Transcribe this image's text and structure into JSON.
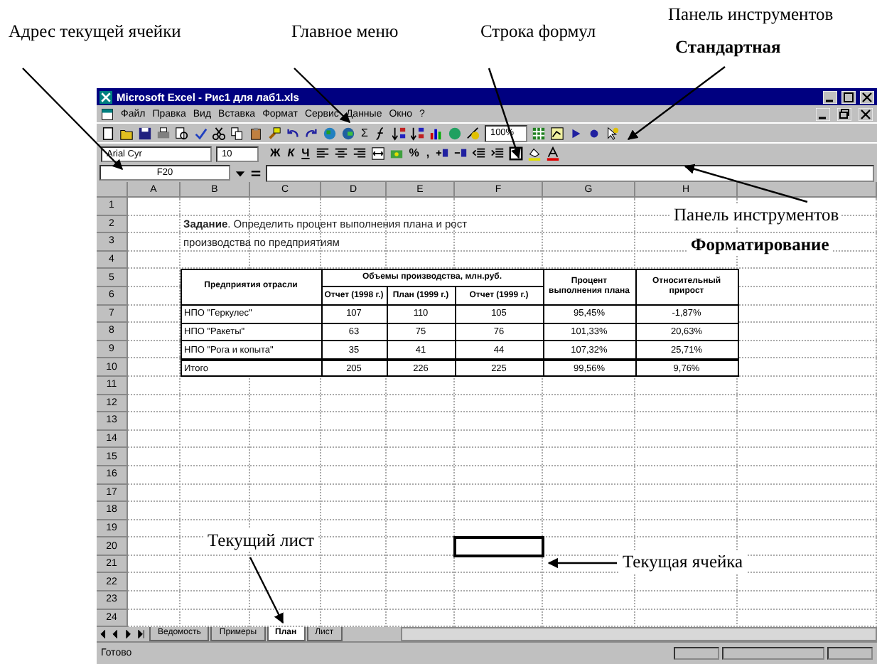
{
  "annotations": {
    "cell_address": "Адрес текущей ячейки",
    "main_menu": "Главное меню",
    "formula_bar": "Строка формул",
    "standard_toolbar": {
      "line1": "Панель инструментов",
      "line2": "Стандартная"
    },
    "formatting_toolbar": {
      "line1": "Панель инструментов",
      "line2": "Форматирование"
    },
    "current_sheet": "Текущий лист",
    "current_cell": "Текущая ячейка"
  },
  "window": {
    "title": "Microsoft Excel - Рис1 для лаб1.xls"
  },
  "menu": [
    "Файл",
    "Правка",
    "Вид",
    "Вставка",
    "Формат",
    "Сервис",
    "Данные",
    "Окно",
    "?"
  ],
  "standard_toolbar": {
    "sum": "Σ",
    "zoom": "100%"
  },
  "formatting_toolbar": {
    "font": "Arial Cyr",
    "size": "10",
    "bold": "Ж",
    "italic": "К",
    "underline": "Ч",
    "percent": "%",
    "comma": ","
  },
  "formula_bar": {
    "name_box": "F20"
  },
  "sheet": {
    "columns": [
      "A",
      "B",
      "C",
      "D",
      "E",
      "F",
      "G",
      "H"
    ],
    "rows": [
      "1",
      "2",
      "3",
      "4",
      "5",
      "6",
      "7",
      "8",
      "9",
      "10",
      "11",
      "12",
      "13",
      "14",
      "15",
      "16",
      "17",
      "18",
      "19",
      "20",
      "21",
      "22",
      "23",
      "24"
    ],
    "task": {
      "line1": "**Задание**. Определить процент выполнения плана и рост",
      "line2": "производства по предприятиям"
    },
    "table": {
      "first_header": "Предприятия отрасли",
      "group_header": "Объемы производства, млн.руб.",
      "sub_headers": [
        "Отчет (1998 г.)",
        "План (1999 г.)",
        "Отчет (1999 г.)"
      ],
      "percent_header": "Процент выполнения плана",
      "growth_header": "Относительный прирост",
      "rows": [
        {
          "cells": [
            "НПО \"Геркулес\"",
            "107",
            "110",
            "105",
            "95,45%",
            "-1,87%"
          ],
          "total": false
        },
        {
          "cells": [
            "НПО \"Ракеты\"",
            "63",
            "75",
            "76",
            "101,33%",
            "20,63%"
          ],
          "total": false
        },
        {
          "cells": [
            "НПО \"Рога и копыта\"",
            "35",
            "41",
            "44",
            "107,32%",
            "25,71%"
          ],
          "total": false
        },
        {
          "cells": [
            "Итого",
            "205",
            "226",
            "225",
            "99,56%",
            "9,76%"
          ],
          "total": true
        }
      ]
    }
  },
  "sheet_tabs": [
    {
      "label": "Ведомость",
      "selected": false
    },
    {
      "label": "Примеры",
      "selected": false
    },
    {
      "label": "План",
      "selected": true
    },
    {
      "label": "Лист",
      "selected": false
    }
  ],
  "status_bar": {
    "text": "Готово"
  }
}
